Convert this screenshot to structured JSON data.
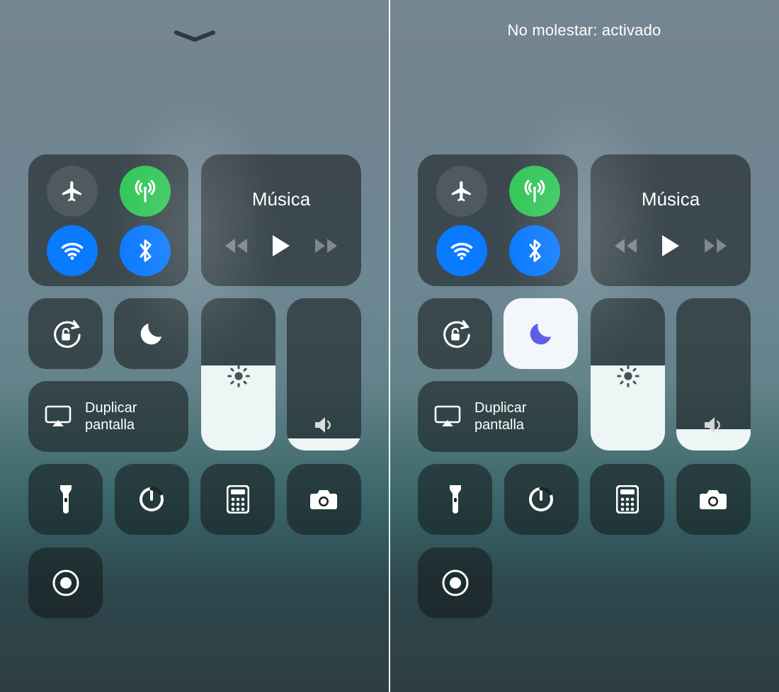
{
  "panes": [
    {
      "top": {
        "type": "chevron"
      },
      "dnd_on": false,
      "brightness_pct": 56,
      "volume_pct": 8
    },
    {
      "top": {
        "type": "message",
        "text": "No molestar: activado"
      },
      "dnd_on": true,
      "brightness_pct": 56,
      "volume_pct": 14
    }
  ],
  "music": {
    "title": "Música"
  },
  "mirror": {
    "label": "Duplicar\npantalla"
  }
}
